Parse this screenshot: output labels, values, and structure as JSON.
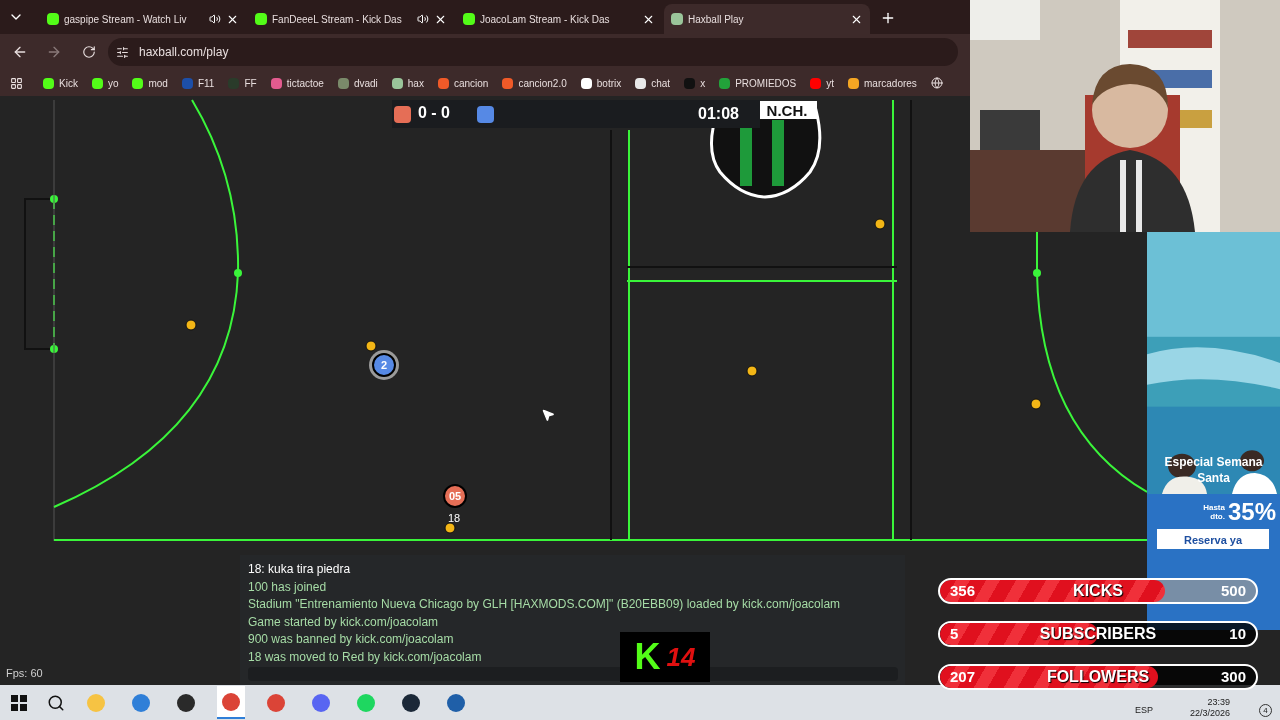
{
  "browser": {
    "tabs": [
      {
        "title": "gaspipe Stream - Watch Liv",
        "selected": false,
        "audio": true,
        "kind": "kick"
      },
      {
        "title": "FanDeeeL Stream - Kick Das",
        "selected": false,
        "audio": true,
        "kind": "kick"
      },
      {
        "title": "JoacoLam Stream - Kick Das",
        "selected": false,
        "audio": false,
        "kind": "kick"
      },
      {
        "title": "Haxball Play",
        "selected": true,
        "audio": false,
        "kind": "haxball"
      }
    ],
    "url": "haxball.com/play",
    "bookmarks": [
      {
        "label": "Kick",
        "color": "#53fc18"
      },
      {
        "label": "yo",
        "color": "#53fc18"
      },
      {
        "label": "mod",
        "color": "#53fc18"
      },
      {
        "label": "F11",
        "color": "#1d4fa8"
      },
      {
        "label": "FF",
        "color": "#2a3b2a"
      },
      {
        "label": "tictactoe",
        "color": "#e35b8f"
      },
      {
        "label": "dvadi",
        "color": "#7a8a6a"
      },
      {
        "label": "hax",
        "color": "#9ac59a"
      },
      {
        "label": "cancion",
        "color": "#f05a28"
      },
      {
        "label": "cancion2.0",
        "color": "#f05a28"
      },
      {
        "label": "botrix",
        "color": "#ffffff"
      },
      {
        "label": "chat",
        "color": "#e8e8e8"
      },
      {
        "label": "x",
        "color": "#111111"
      },
      {
        "label": "PROMIEDOS",
        "color": "#22a33a"
      },
      {
        "label": "yt",
        "color": "#ff0000"
      },
      {
        "label": "marcadores",
        "color": "#f5a623"
      }
    ]
  },
  "game": {
    "score": "0 - 0",
    "time": "01:08",
    "crest_text": "N.CH.",
    "players": [
      {
        "number": "2",
        "color": "#5689e5",
        "self": true
      },
      {
        "number": "05",
        "color": "#e56e56",
        "self": false,
        "name": "18"
      }
    ]
  },
  "chat": {
    "messages": [
      {
        "kind": "player",
        "text": "18: kuka tira piedra"
      },
      {
        "kind": "notice",
        "text": "100 has joined"
      },
      {
        "kind": "notice",
        "text": "Stadium \"Entrenamiento Nueva Chicago by GLH [HAXMODS.COM]\" (B20EBB09) loaded by kick.com/joacolam"
      },
      {
        "kind": "notice",
        "text": "Game started by kick.com/joacolam"
      },
      {
        "kind": "notice",
        "text": "900 was banned by kick.com/joacolam"
      },
      {
        "kind": "notice",
        "text": "18 was moved to Red by kick.com/joacolam"
      }
    ]
  },
  "fps": "Fps: 60",
  "stream_overlay": {
    "logo_letter": "K",
    "logo_number": "14",
    "goals": [
      {
        "count": "356",
        "label": "KICKS",
        "target": "500",
        "level": 0.712
      },
      {
        "count": "5",
        "label": "SUBSCRIBERS",
        "target": "10",
        "level": 0.5
      },
      {
        "count": "207",
        "label": "FOLLOWERS",
        "target": "300",
        "level": 0.69
      }
    ]
  },
  "ad": {
    "title": "Especial Semana Santa",
    "prefix_1": "Hasta",
    "prefix_2": "dto.",
    "discount": "35%",
    "button": "Reserva ya"
  },
  "taskbar": {
    "apps": [
      {
        "kind": "explorer",
        "active": false
      },
      {
        "kind": "store",
        "active": false
      },
      {
        "kind": "obs",
        "active": false
      },
      {
        "kind": "chrome",
        "active": true
      },
      {
        "kind": "chrome",
        "active": false
      },
      {
        "kind": "discord",
        "active": false
      },
      {
        "kind": "spotify",
        "active": false
      },
      {
        "kind": "steam",
        "active": false
      },
      {
        "kind": "app",
        "active": false
      }
    ],
    "language": "ESP",
    "time": "23:39",
    "date": "22/3/2026",
    "notifications": "4"
  }
}
